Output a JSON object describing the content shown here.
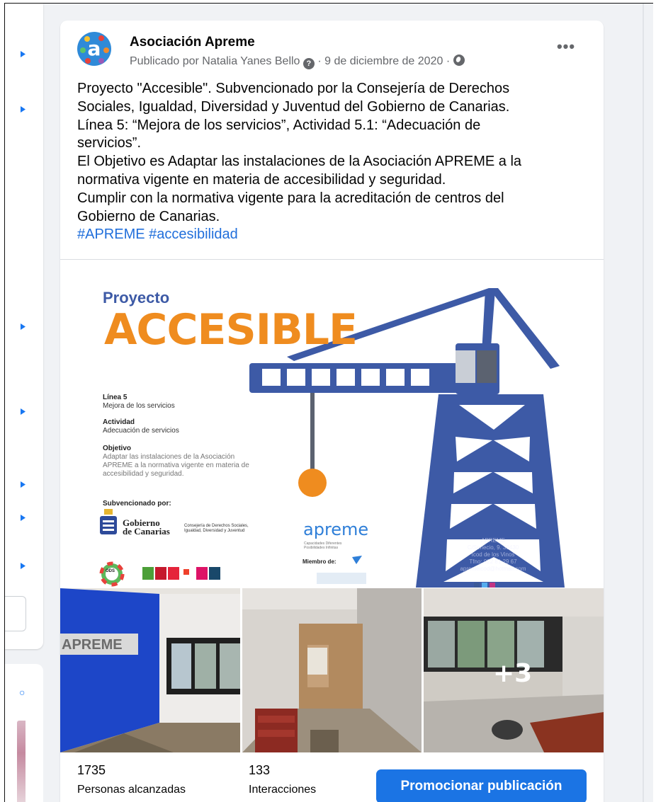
{
  "post": {
    "page_name": "Asociación Apreme",
    "meta": {
      "published_by": "Publicado por Natalia Yanes Bello",
      "date": "9 de diciembre de 2020",
      "separator": "·"
    },
    "more_label": "•••",
    "body_lines": [
      "Proyecto \"Accesible\". Subvencionado por la Consejería de Derechos",
      "Sociales, Igualdad, Diversidad y Juventud del Gobierno de Canarias.",
      "Línea 5: “Mejora de los servicios”, Actividad 5.1: “Adecuación de",
      "servicios”.",
      "El Objetivo es Adaptar las instalaciones de la Asociación APREME a la",
      "normativa vigente en materia de accesibilidad y seguridad.",
      "Cumplir con la normativa vigente para la acreditación de centros del",
      "Gobierno de Canarias."
    ],
    "hashtags": "#APREME #accesibilidad"
  },
  "poster": {
    "proyecto": "Proyecto",
    "accesible": "ACCESIBLE",
    "linea_label": "Línea 5",
    "linea_value": "Mejora de los servicios",
    "actividad_label": "Actividad",
    "actividad_value": "Adecuación de servicios",
    "objetivo_label": "Objetivo",
    "objetivo_lines": [
      "Adaptar las instalaciones de la Asociación",
      "APREME a la normativa vigente en materia de",
      "accesibilidad y seguridad."
    ],
    "subvencionado": "Subvencionado por:",
    "gobierno_lines": [
      "Gobierno",
      "de Canarias"
    ],
    "consejeria_lines": [
      "Consejería de Derechos Sociales,",
      "Igualdad, Diversidad y Juventud"
    ],
    "apreme_logo": "apreme",
    "apreme_tagline": [
      "Capacidades Diferentes",
      "Posibilidades Infinitas"
    ],
    "miembro": "Miembro de:",
    "ods": "ODS",
    "contact_lines": [
      "APREME",
      "C/Senecio, 9. 38430",
      "Icod de los Vinos",
      "Tfno: 922 81 29 67",
      "apremeicod@hotmail.com"
    ]
  },
  "photos": {
    "extra_count": "+3"
  },
  "stats": {
    "reach_value": "1735",
    "reach_label": "Personas alcanzadas",
    "interactions_value": "133",
    "interactions_label": "Interacciones",
    "promote_label": "Promocionar publicación"
  },
  "colors": {
    "accent_blue": "#1b74e4",
    "hashtag_blue": "#216fdb",
    "crane_blue": "#3d5aa6",
    "poster_orange": "#ef8c1f",
    "wall_blue": "#1d46c8"
  },
  "icons": [
    "avatar-logo",
    "question-badge-icon",
    "globe-icon",
    "more-options-icon",
    "crane-illustration"
  ]
}
